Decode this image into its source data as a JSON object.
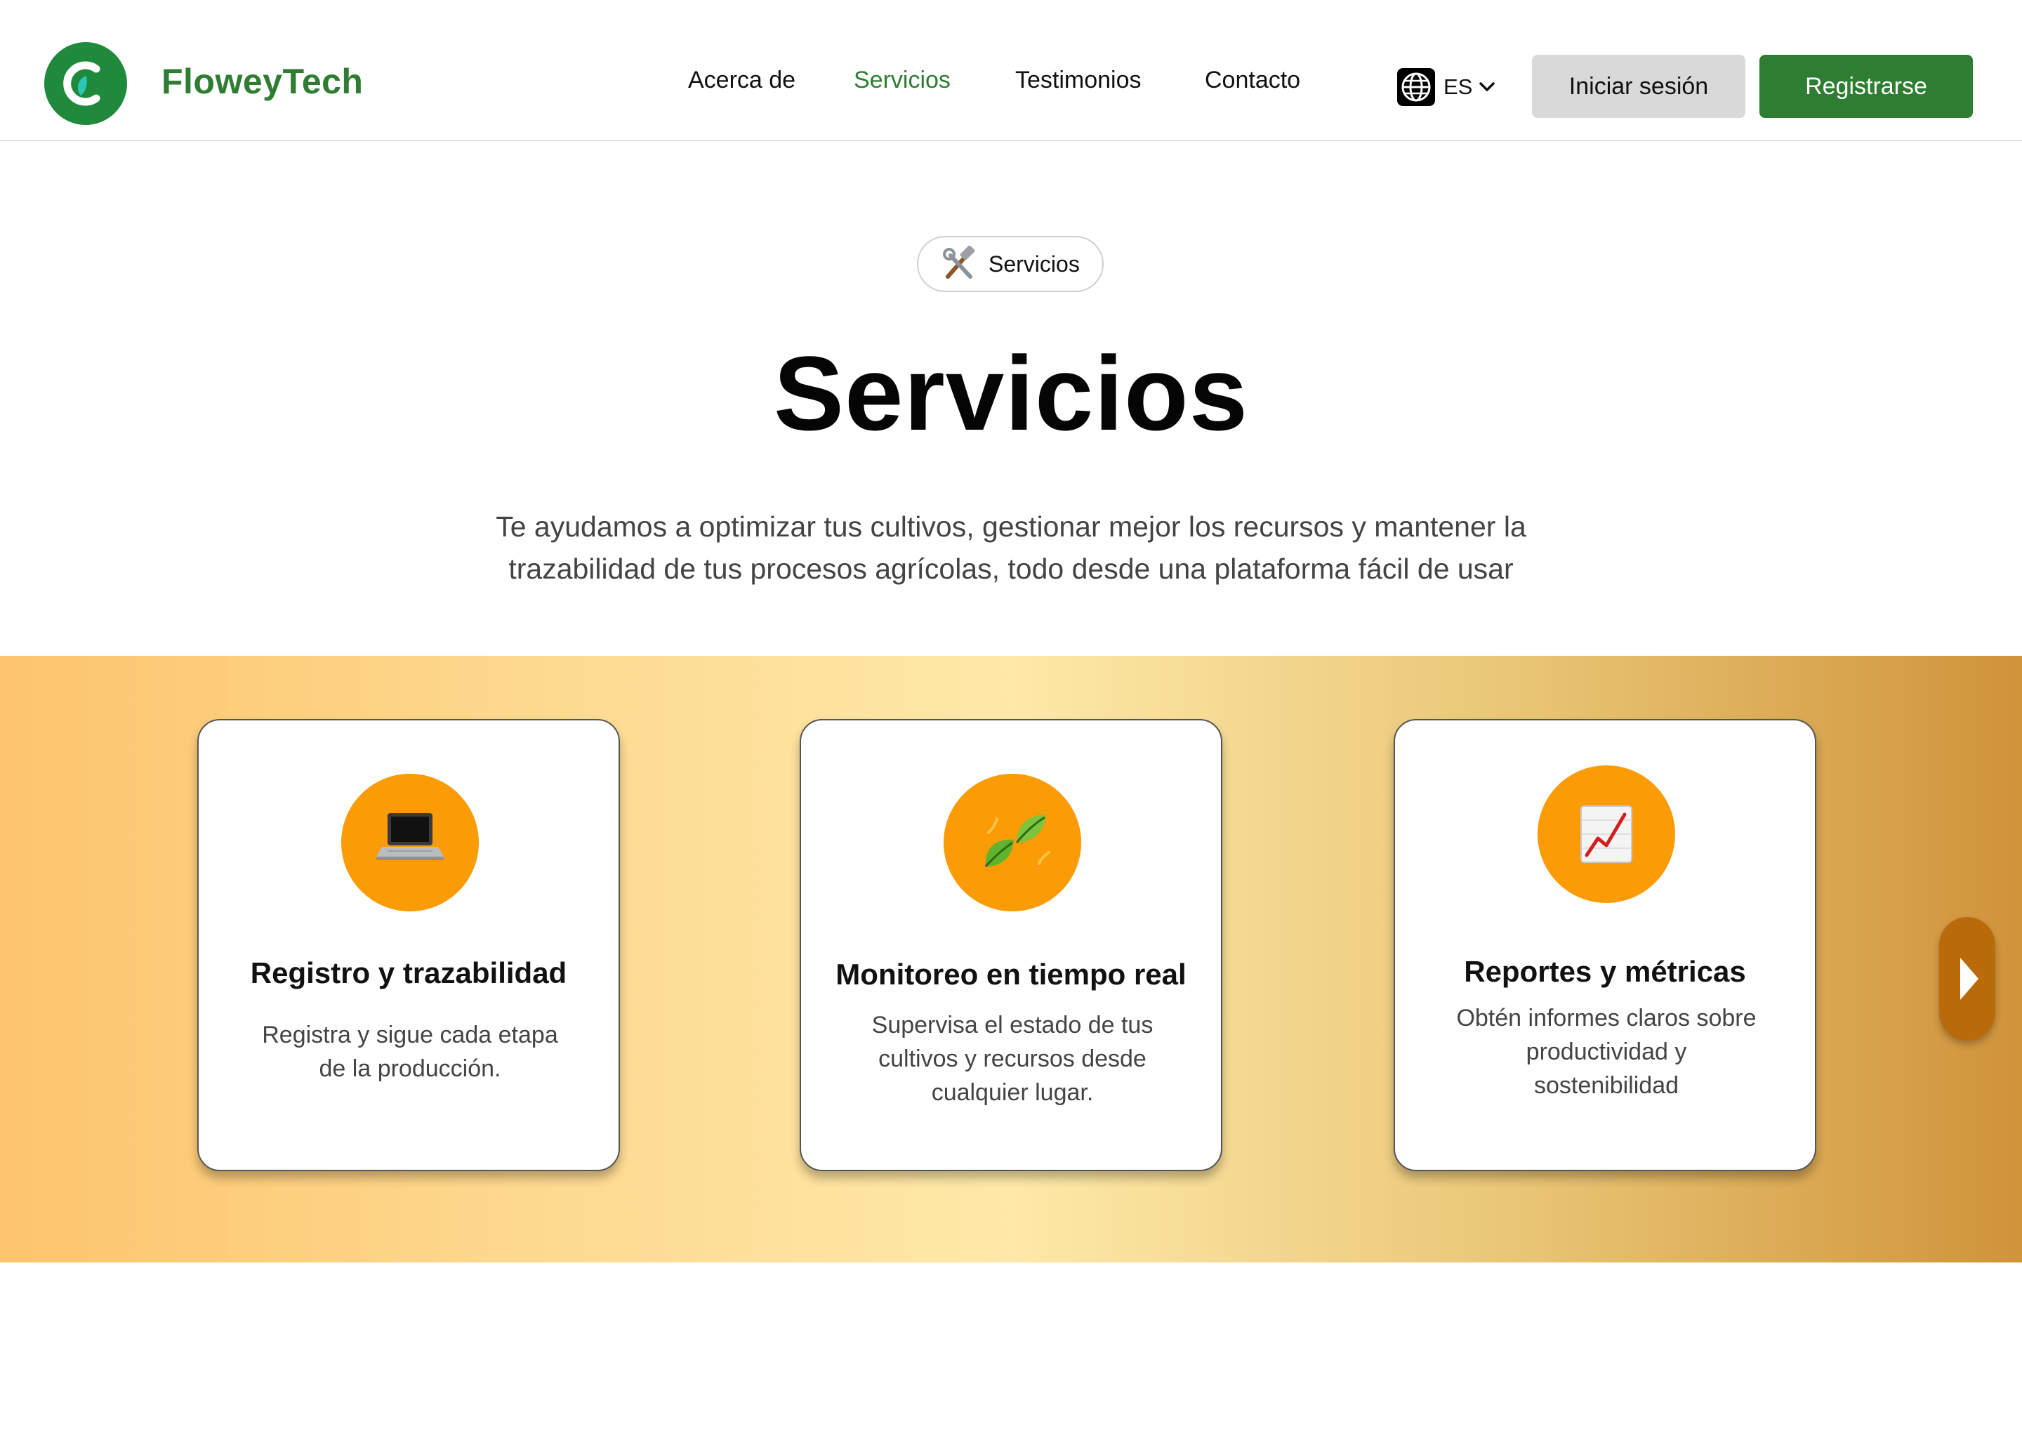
{
  "header": {
    "brand": "FloweyTech",
    "logo_icon": "logo-c-leaf-icon",
    "nav": [
      {
        "label": "Acerca de",
        "active": false
      },
      {
        "label": "Servicios",
        "active": true
      },
      {
        "label": "Testimonios",
        "active": false
      },
      {
        "label": "Contacto",
        "active": false
      }
    ],
    "language": {
      "code": "ES",
      "icon": "globe-icon"
    },
    "login_label": "Iniciar sesión",
    "register_label": "Registrarse"
  },
  "hero": {
    "badge_icon": "hammer-wrench-icon",
    "badge_label": "Servicios",
    "title": "Servicios",
    "subtitle_line1": "Te ayudamos a optimizar tus cultivos, gestionar mejor los recursos y mantener la",
    "subtitle_line2": "trazabilidad de tus procesos agrícolas, todo desde una plataforma fácil de usar"
  },
  "services": [
    {
      "icon": "laptop-icon",
      "title": "Registro y trazabilidad",
      "desc_lines": [
        "Registra y sigue cada etapa",
        "de la producción."
      ]
    },
    {
      "icon": "leaves-icon",
      "title": "Monitoreo en tiempo real",
      "desc_lines": [
        "Supervisa el estado de tus",
        "cultivos y recursos desde",
        "cualquier lugar."
      ]
    },
    {
      "icon": "chart-increasing-icon",
      "title": "Reportes y métricas",
      "desc_lines": [
        "Obtén informes claros sobre",
        "productividad y",
        "sostenibilidad"
      ]
    }
  ],
  "carousel": {
    "next_icon": "chevron-right-icon"
  },
  "colors": {
    "brand_green": "#2e7d32",
    "logo_green": "#1f8a3b",
    "icon_orange": "#fb9b05",
    "carousel_button": "#b96b0a",
    "login_button_bg": "#d9d9d9"
  }
}
